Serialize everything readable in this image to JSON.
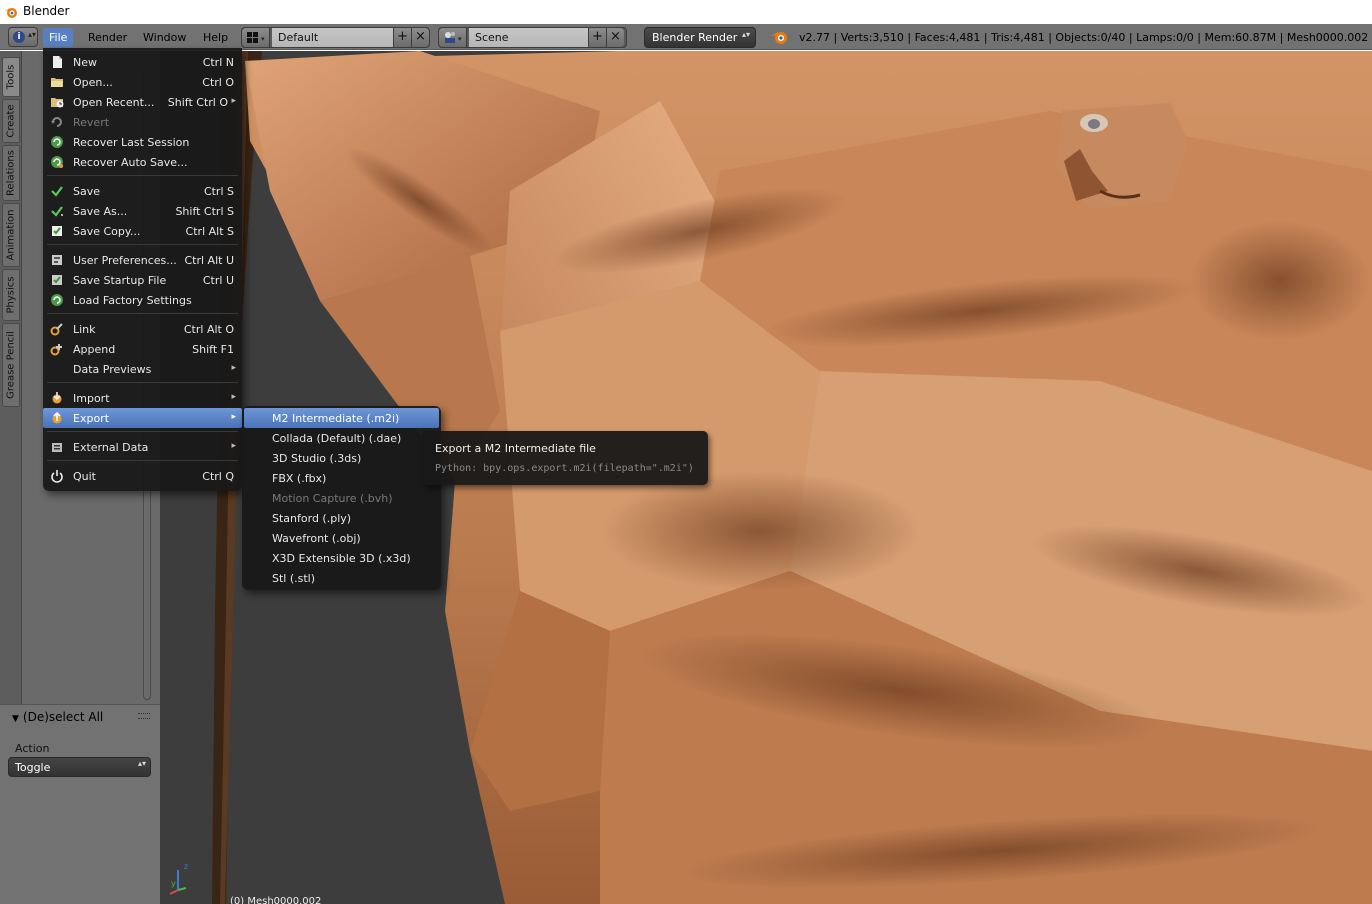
{
  "window": {
    "title": "Blender"
  },
  "header": {
    "editor_icon": "info-icon",
    "menus": [
      "File",
      "Render",
      "Window",
      "Help"
    ],
    "screen_layout": "Default",
    "scene": "Scene",
    "render_engine": "Blender Render",
    "stats": "v2.77 | Verts:3,510 | Faces:4,481 | Tris:4,481 | Objects:0/40 | Lamps:0/0 | Mem:60.87M | Mesh0000.002"
  },
  "tool_tabs": [
    "Tools",
    "Create",
    "Relations",
    "Animation",
    "Physics",
    "Grease Pencil"
  ],
  "operator_panel": {
    "title": "(De)select All",
    "action_label": "Action",
    "action_value": "Toggle"
  },
  "file_menu": {
    "items": [
      {
        "label": "New",
        "shortcut": "Ctrl N",
        "icon": "new-file-icon"
      },
      {
        "label": "Open...",
        "shortcut": "Ctrl O",
        "icon": "folder-open-icon"
      },
      {
        "label": "Open Recent...",
        "shortcut": "Shift Ctrl O",
        "icon": "open-recent-icon"
      },
      {
        "label": "Revert",
        "shortcut": "",
        "icon": "revert-icon",
        "disabled": true
      },
      {
        "label": "Recover Last Session",
        "shortcut": "",
        "icon": "recover-icon"
      },
      {
        "label": "Recover Auto Save...",
        "shortcut": "",
        "icon": "recover-auto-icon"
      },
      {
        "label": "Save",
        "shortcut": "Ctrl S",
        "icon": "check-icon"
      },
      {
        "label": "Save As...",
        "shortcut": "Shift Ctrl S",
        "icon": "save-as-icon"
      },
      {
        "label": "Save Copy...",
        "shortcut": "Ctrl Alt S",
        "icon": "save-copy-icon"
      },
      {
        "label": "User Preferences...",
        "shortcut": "Ctrl Alt U",
        "icon": "preferences-icon"
      },
      {
        "label": "Save Startup File",
        "shortcut": "Ctrl U",
        "icon": "save-startup-icon"
      },
      {
        "label": "Load Factory Settings",
        "shortcut": "",
        "icon": "load-factory-icon"
      },
      {
        "label": "Link",
        "shortcut": "Ctrl Alt O",
        "icon": "link-icon"
      },
      {
        "label": "Append",
        "shortcut": "Shift F1",
        "icon": "append-icon"
      },
      {
        "label": "Data Previews",
        "shortcut": "",
        "icon": ""
      },
      {
        "label": "Import",
        "shortcut": "",
        "icon": "import-icon"
      },
      {
        "label": "Export",
        "shortcut": "",
        "icon": "export-icon"
      },
      {
        "label": "External Data",
        "shortcut": "",
        "icon": "external-data-icon"
      },
      {
        "label": "Quit",
        "shortcut": "Ctrl Q",
        "icon": "power-icon"
      }
    ]
  },
  "export_menu": {
    "items": [
      {
        "label": "M2 Intermediate (.m2i)",
        "highlighted": true
      },
      {
        "label": "Collada (Default) (.dae)"
      },
      {
        "label": "3D Studio (.3ds)"
      },
      {
        "label": "FBX (.fbx)"
      },
      {
        "label": "Motion Capture (.bvh)",
        "disabled": true
      },
      {
        "label": "Stanford (.ply)"
      },
      {
        "label": "Wavefront (.obj)"
      },
      {
        "label": "X3D Extensible 3D (.x3d)"
      },
      {
        "label": "Stl (.stl)"
      }
    ]
  },
  "tooltip": {
    "title": "Export a M2 Intermediate file",
    "python": "Python: bpy.ops.export.m2i(filepath=\".m2i\")"
  },
  "viewport": {
    "object_label": "(0) Mesh0000.002"
  },
  "colors": {
    "menu_highlight": "#5680c2",
    "menu_bg": "#181818",
    "header_bg": "#727272",
    "skin": "#c98a5a"
  }
}
